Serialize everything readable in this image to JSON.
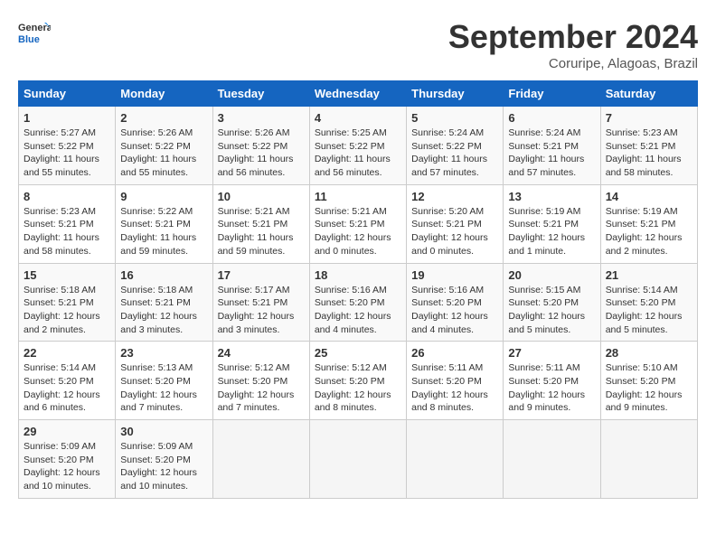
{
  "header": {
    "logo_line1": "General",
    "logo_line2": "Blue",
    "month": "September 2024",
    "location": "Coruripe, Alagoas, Brazil"
  },
  "weekdays": [
    "Sunday",
    "Monday",
    "Tuesday",
    "Wednesday",
    "Thursday",
    "Friday",
    "Saturday"
  ],
  "weeks": [
    [
      {
        "day": "1",
        "info": "Sunrise: 5:27 AM\nSunset: 5:22 PM\nDaylight: 11 hours\nand 55 minutes."
      },
      {
        "day": "2",
        "info": "Sunrise: 5:26 AM\nSunset: 5:22 PM\nDaylight: 11 hours\nand 55 minutes."
      },
      {
        "day": "3",
        "info": "Sunrise: 5:26 AM\nSunset: 5:22 PM\nDaylight: 11 hours\nand 56 minutes."
      },
      {
        "day": "4",
        "info": "Sunrise: 5:25 AM\nSunset: 5:22 PM\nDaylight: 11 hours\nand 56 minutes."
      },
      {
        "day": "5",
        "info": "Sunrise: 5:24 AM\nSunset: 5:22 PM\nDaylight: 11 hours\nand 57 minutes."
      },
      {
        "day": "6",
        "info": "Sunrise: 5:24 AM\nSunset: 5:21 PM\nDaylight: 11 hours\nand 57 minutes."
      },
      {
        "day": "7",
        "info": "Sunrise: 5:23 AM\nSunset: 5:21 PM\nDaylight: 11 hours\nand 58 minutes."
      }
    ],
    [
      {
        "day": "8",
        "info": "Sunrise: 5:23 AM\nSunset: 5:21 PM\nDaylight: 11 hours\nand 58 minutes."
      },
      {
        "day": "9",
        "info": "Sunrise: 5:22 AM\nSunset: 5:21 PM\nDaylight: 11 hours\nand 59 minutes."
      },
      {
        "day": "10",
        "info": "Sunrise: 5:21 AM\nSunset: 5:21 PM\nDaylight: 11 hours\nand 59 minutes."
      },
      {
        "day": "11",
        "info": "Sunrise: 5:21 AM\nSunset: 5:21 PM\nDaylight: 12 hours\nand 0 minutes."
      },
      {
        "day": "12",
        "info": "Sunrise: 5:20 AM\nSunset: 5:21 PM\nDaylight: 12 hours\nand 0 minutes."
      },
      {
        "day": "13",
        "info": "Sunrise: 5:19 AM\nSunset: 5:21 PM\nDaylight: 12 hours\nand 1 minute."
      },
      {
        "day": "14",
        "info": "Sunrise: 5:19 AM\nSunset: 5:21 PM\nDaylight: 12 hours\nand 2 minutes."
      }
    ],
    [
      {
        "day": "15",
        "info": "Sunrise: 5:18 AM\nSunset: 5:21 PM\nDaylight: 12 hours\nand 2 minutes."
      },
      {
        "day": "16",
        "info": "Sunrise: 5:18 AM\nSunset: 5:21 PM\nDaylight: 12 hours\nand 3 minutes."
      },
      {
        "day": "17",
        "info": "Sunrise: 5:17 AM\nSunset: 5:21 PM\nDaylight: 12 hours\nand 3 minutes."
      },
      {
        "day": "18",
        "info": "Sunrise: 5:16 AM\nSunset: 5:20 PM\nDaylight: 12 hours\nand 4 minutes."
      },
      {
        "day": "19",
        "info": "Sunrise: 5:16 AM\nSunset: 5:20 PM\nDaylight: 12 hours\nand 4 minutes."
      },
      {
        "day": "20",
        "info": "Sunrise: 5:15 AM\nSunset: 5:20 PM\nDaylight: 12 hours\nand 5 minutes."
      },
      {
        "day": "21",
        "info": "Sunrise: 5:14 AM\nSunset: 5:20 PM\nDaylight: 12 hours\nand 5 minutes."
      }
    ],
    [
      {
        "day": "22",
        "info": "Sunrise: 5:14 AM\nSunset: 5:20 PM\nDaylight: 12 hours\nand 6 minutes."
      },
      {
        "day": "23",
        "info": "Sunrise: 5:13 AM\nSunset: 5:20 PM\nDaylight: 12 hours\nand 7 minutes."
      },
      {
        "day": "24",
        "info": "Sunrise: 5:12 AM\nSunset: 5:20 PM\nDaylight: 12 hours\nand 7 minutes."
      },
      {
        "day": "25",
        "info": "Sunrise: 5:12 AM\nSunset: 5:20 PM\nDaylight: 12 hours\nand 8 minutes."
      },
      {
        "day": "26",
        "info": "Sunrise: 5:11 AM\nSunset: 5:20 PM\nDaylight: 12 hours\nand 8 minutes."
      },
      {
        "day": "27",
        "info": "Sunrise: 5:11 AM\nSunset: 5:20 PM\nDaylight: 12 hours\nand 9 minutes."
      },
      {
        "day": "28",
        "info": "Sunrise: 5:10 AM\nSunset: 5:20 PM\nDaylight: 12 hours\nand 9 minutes."
      }
    ],
    [
      {
        "day": "29",
        "info": "Sunrise: 5:09 AM\nSunset: 5:20 PM\nDaylight: 12 hours\nand 10 minutes."
      },
      {
        "day": "30",
        "info": "Sunrise: 5:09 AM\nSunset: 5:20 PM\nDaylight: 12 hours\nand 10 minutes."
      },
      {
        "day": "",
        "info": ""
      },
      {
        "day": "",
        "info": ""
      },
      {
        "day": "",
        "info": ""
      },
      {
        "day": "",
        "info": ""
      },
      {
        "day": "",
        "info": ""
      }
    ]
  ]
}
